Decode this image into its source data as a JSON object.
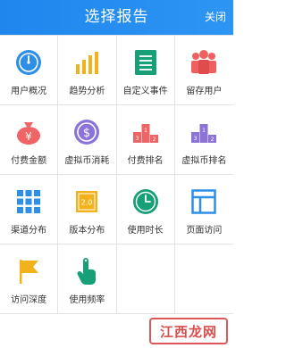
{
  "header": {
    "title": "选择报告",
    "close_label": "关闭",
    "color": "#2590f0"
  },
  "items": [
    {
      "label": "用户概况",
      "icon": "clock-icon",
      "color": "#2d8fe6"
    },
    {
      "label": "趋势分析",
      "icon": "bar-chart-icon",
      "color": "#f2b21b"
    },
    {
      "label": "自定义事件",
      "icon": "document-icon",
      "color": "#17a078"
    },
    {
      "label": "留存用户",
      "icon": "users-icon",
      "color": "#ef6161"
    },
    {
      "label": "付费金额",
      "icon": "yen-bag-icon",
      "color": "#ef6464"
    },
    {
      "label": "虚拟币消耗",
      "icon": "dollar-coin-icon",
      "color": "#8c73d8"
    },
    {
      "label": "付费排名",
      "icon": "podium-icon",
      "color": "#ef6464"
    },
    {
      "label": "虚拟币排名",
      "icon": "podium-icon",
      "color": "#8c73d8"
    },
    {
      "label": "渠道分布",
      "icon": "grid-icon",
      "color": "#2d8fe6"
    },
    {
      "label": "版本分布",
      "icon": "version-icon",
      "color": "#f2b21b",
      "icon_text": "2.0"
    },
    {
      "label": "使用时长",
      "icon": "timer-icon",
      "color": "#17a078"
    },
    {
      "label": "页面访问",
      "icon": "layout-icon",
      "color": "#2d8fe6"
    },
    {
      "label": "访问深度",
      "icon": "flag-icon",
      "color": "#f2b21b"
    },
    {
      "label": "使用频率",
      "icon": "tap-icon",
      "color": "#17a078"
    }
  ],
  "watermark": "江西龙网"
}
